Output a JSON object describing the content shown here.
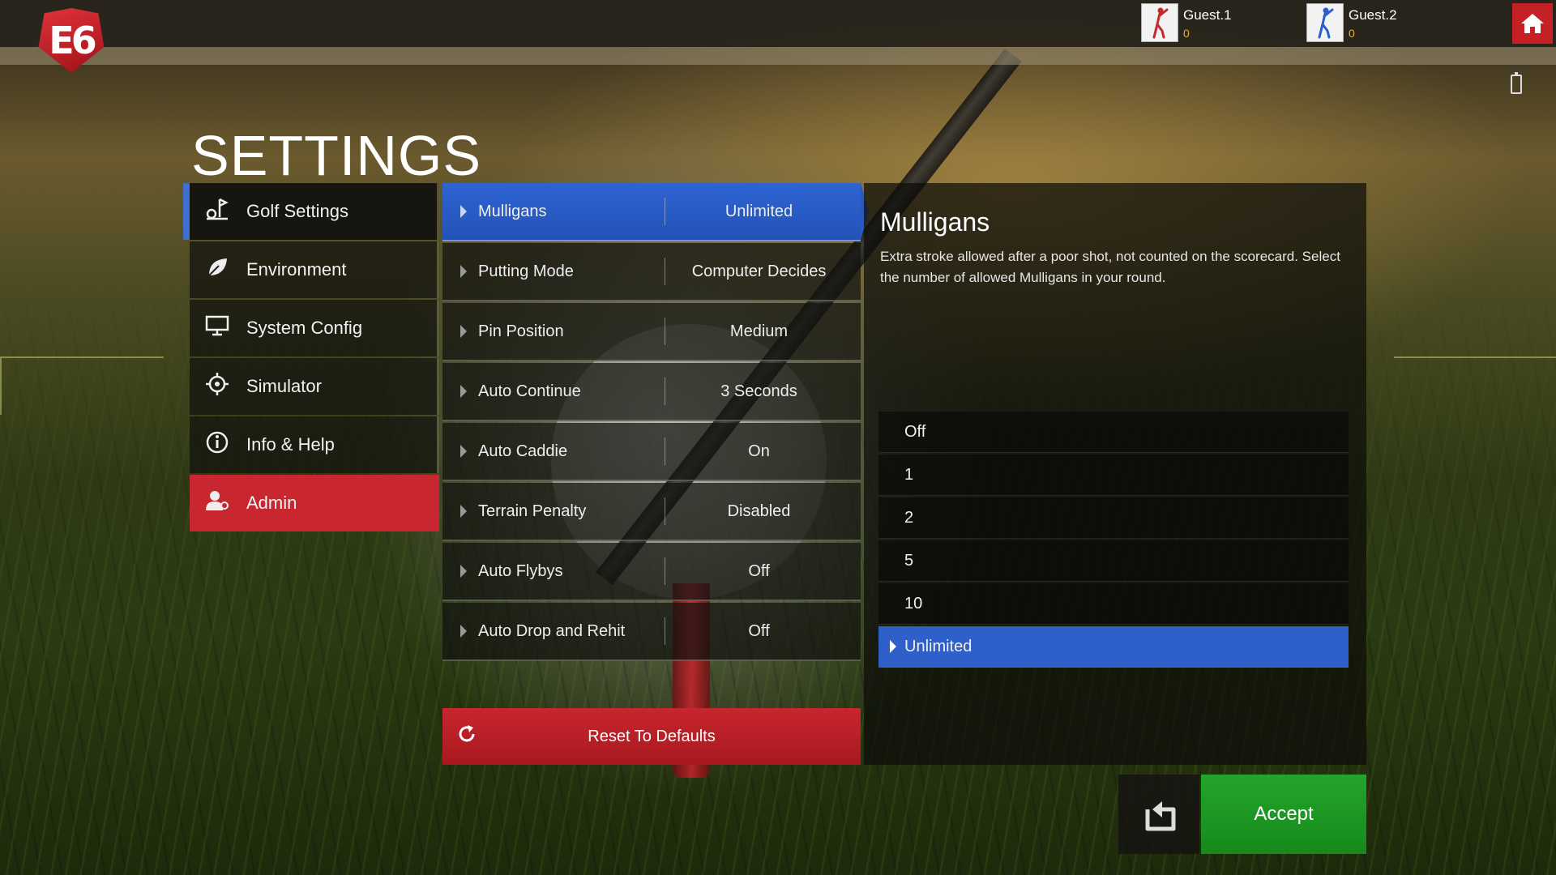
{
  "app": {
    "logo_text": "E6"
  },
  "players": [
    {
      "name": "Guest.1",
      "score": "0",
      "color": "#c8272f"
    },
    {
      "name": "Guest.2",
      "score": "0",
      "color": "#2a5fc9"
    }
  ],
  "page": {
    "title": "SETTINGS"
  },
  "menu": {
    "items": [
      {
        "label": "Golf Settings",
        "icon": "golf-settings-icon",
        "active": true
      },
      {
        "label": "Environment",
        "icon": "leaf-icon"
      },
      {
        "label": "System Config",
        "icon": "monitor-icon"
      },
      {
        "label": "Simulator",
        "icon": "crosshair-icon"
      },
      {
        "label": "Info & Help",
        "icon": "info-icon"
      },
      {
        "label": "Admin",
        "icon": "admin-user-icon",
        "highlight": true
      }
    ]
  },
  "options": [
    {
      "name": "Mulligans",
      "value": "Unlimited",
      "active": true
    },
    {
      "name": "Putting Mode",
      "value": "Computer Decides"
    },
    {
      "name": "Pin Position",
      "value": "Medium"
    },
    {
      "name": "Auto Continue",
      "value": "3 Seconds"
    },
    {
      "name": "Auto Caddie",
      "value": "On"
    },
    {
      "name": "Terrain Penalty",
      "value": "Disabled"
    },
    {
      "name": "Auto Flybys",
      "value": "Off"
    },
    {
      "name": "Auto Drop and Rehit",
      "value": "Off"
    }
  ],
  "reset": {
    "label": "Reset To Defaults"
  },
  "detail": {
    "title": "Mulligans",
    "description": "Extra stroke allowed after a poor shot, not counted on the scorecard. Select the number of allowed Mulligans in your round.",
    "choices": [
      "Off",
      "1",
      "2",
      "5",
      "10",
      "Unlimited"
    ],
    "selected_index": 5
  },
  "actions": {
    "accept_label": "Accept"
  },
  "colors": {
    "accent_blue": "#2f5fc9",
    "accent_red": "#c8272f",
    "accept_green": "#1e9a24"
  }
}
